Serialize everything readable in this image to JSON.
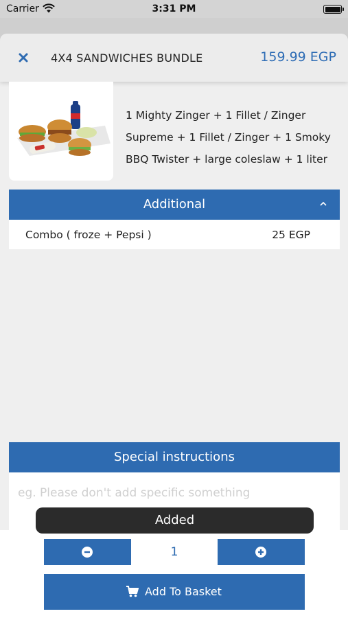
{
  "status_bar": {
    "carrier": "Carrier",
    "time": "3:31 PM"
  },
  "header": {
    "title": "4X4 SANDWICHES BUNDLE",
    "price": "159.99 EGP"
  },
  "product": {
    "description": "1 Mighty Zinger + 1 Fillet / Zinger Supreme + 1 Fillet / Zinger + 1 Smoky BBQ Twister + large coleslaw + 1 liter"
  },
  "additional": {
    "title": "Additional",
    "items": [
      {
        "name": "Combo ( froze + Pepsi )",
        "price": "25 EGP"
      }
    ]
  },
  "special_instructions": {
    "title": "Special instructions",
    "placeholder": "eg. Please don't add specific something"
  },
  "quantity": {
    "value": "1"
  },
  "actions": {
    "add_to_basket": "Add To Basket"
  },
  "toast": {
    "message": "Added"
  },
  "colors": {
    "accent": "#2e6bb1",
    "toast_bg": "#2b2b2b"
  }
}
